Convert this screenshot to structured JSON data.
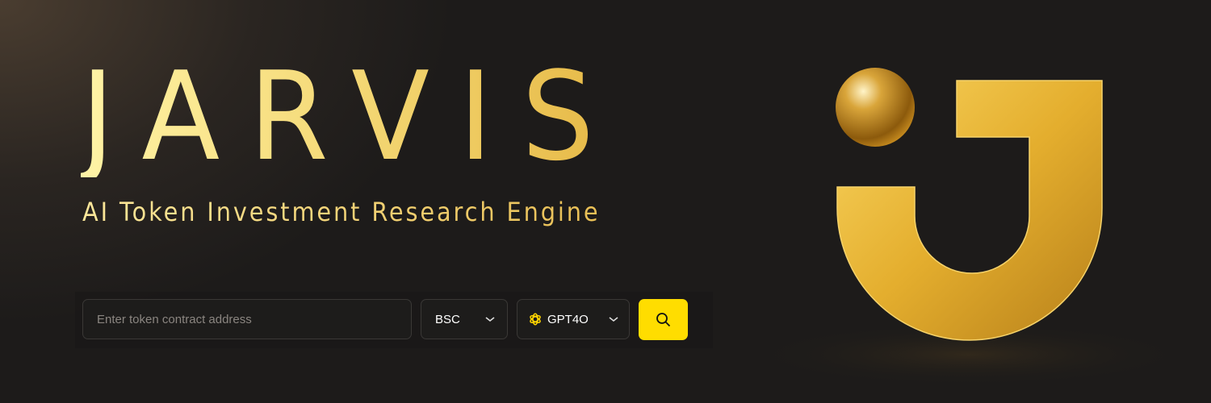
{
  "hero": {
    "title": "JARVIS",
    "subtitle": "AI Token Investment Research Engine"
  },
  "search": {
    "placeholder": "Enter token contract address",
    "chain_value": "BSC",
    "model_value": "GPT4O",
    "model_icon": "openai-icon",
    "search_icon": "search-icon"
  },
  "colors": {
    "accent": "#ffdd00",
    "gold": "#e6b845"
  }
}
